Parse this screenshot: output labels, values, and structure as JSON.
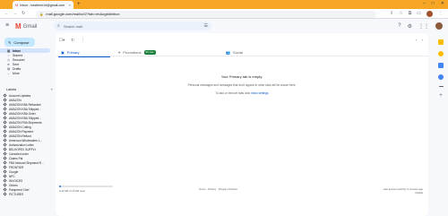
{
  "browser": {
    "tab_title": "Inbox - bestberd.hl@gmail.com",
    "url": "mail.google.com/mail/u/0/?tab=rm&ogbl#inbox"
  },
  "header": {
    "app_name": "Gmail",
    "search_placeholder": "Search mail"
  },
  "compose_label": "Compose",
  "nav": [
    {
      "label": "Inbox",
      "active": true
    },
    {
      "label": "Starred"
    },
    {
      "label": "Snoozed"
    },
    {
      "label": "Sent"
    },
    {
      "label": "Drafts"
    },
    {
      "label": "More"
    }
  ],
  "labels_title": "Labels",
  "labels": [
    "Account Updates",
    "AMAZON",
    "AMAZON KBA Refunded",
    "AMAZON KBA Shipped...",
    "AMAZON KBA Order",
    "AMAZON KBA Shipped...",
    "AMAZON FBA Shipments",
    "AMAZON Cutting",
    "AMAZON Payment",
    "AMAZON Refund",
    "American Wholesalers L...",
    "Authorization Letter",
    "BELHOPEX SUPPLY",
    "Canceled order",
    "Claims Pal",
    "FBA Inbound Shipment R...",
    "FRONTIER",
    "Google",
    "NPC",
    "INVOICES",
    "Orders",
    "Pampered Chef",
    "PICTURES"
  ],
  "main": {
    "tabs": [
      {
        "label": "Primary",
        "selected": true
      },
      {
        "label": "Promotions",
        "badge": "50 new"
      },
      {
        "label": "Social"
      }
    ],
    "pager": "",
    "empty_title": "Your Primary tab is empty.",
    "empty_desc": "Personal messages and messages that don't appear in other tabs will be shown here.",
    "empty_hint_prefix": "To add or remove tabs click",
    "empty_hint_link": "inbox settings",
    "storage_text": "0.42 GB of 15 GB used",
    "storage_fraction": 0.03,
    "terms": "Terms · Privacy · Program Policies",
    "activity": "Last account activity: 0 minutes ago",
    "details": "Details"
  }
}
